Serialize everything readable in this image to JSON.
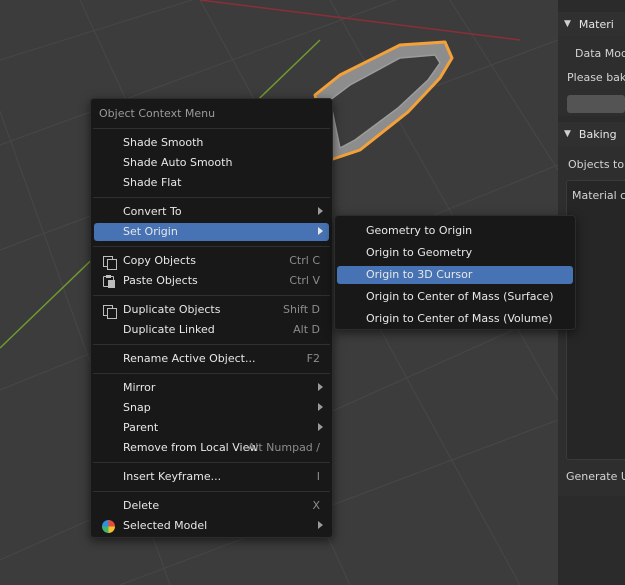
{
  "context_menu": {
    "title": "Object Context Menu",
    "items": [
      {
        "label": "Shade Smooth"
      },
      {
        "label": "Shade Auto Smooth"
      },
      {
        "label": "Shade Flat"
      },
      {
        "label": "Convert To",
        "submenu": true
      },
      {
        "label": "Set Origin",
        "submenu": true,
        "highlighted": true
      },
      {
        "label": "Copy Objects",
        "shortcut": "Ctrl C",
        "icon": "copy-icon"
      },
      {
        "label": "Paste Objects",
        "shortcut": "Ctrl V",
        "icon": "paste-icon"
      },
      {
        "label": "Duplicate Objects",
        "shortcut": "Shift D",
        "icon": "duplicate-icon"
      },
      {
        "label": "Duplicate Linked",
        "shortcut": "Alt D"
      },
      {
        "label": "Rename Active Object...",
        "shortcut": "F2"
      },
      {
        "label": "Mirror",
        "submenu": true
      },
      {
        "label": "Snap",
        "submenu": true
      },
      {
        "label": "Parent",
        "submenu": true
      },
      {
        "label": "Remove from Local View",
        "shortcut": "Alt Numpad /"
      },
      {
        "label": "Insert Keyframe...",
        "shortcut": "I"
      },
      {
        "label": "Delete",
        "shortcut": "X"
      },
      {
        "label": "Selected Model",
        "submenu": true,
        "icon": "selected-model-icon"
      }
    ]
  },
  "set_origin_submenu": {
    "items": [
      {
        "label": "Geometry to Origin"
      },
      {
        "label": "Origin to Geometry"
      },
      {
        "label": "Origin to 3D Cursor",
        "highlighted": true
      },
      {
        "label": "Origin to Center of Mass (Surface)"
      },
      {
        "label": "Origin to Center of Mass (Volume)"
      }
    ]
  },
  "properties_panel": {
    "section1_title": "Materi",
    "data_mode_label": "Data Mode",
    "please_bake_text": "Please bake",
    "section2_title": "Baking",
    "objects_to_label": "Objects to .",
    "material_label": "Material ch",
    "generate_label": "Generate U"
  },
  "colors": {
    "highlight": "#4772b3",
    "selection_outline": "#f5a13a",
    "x_axis": "#8b2f36",
    "y_axis": "#6f9b2e"
  }
}
